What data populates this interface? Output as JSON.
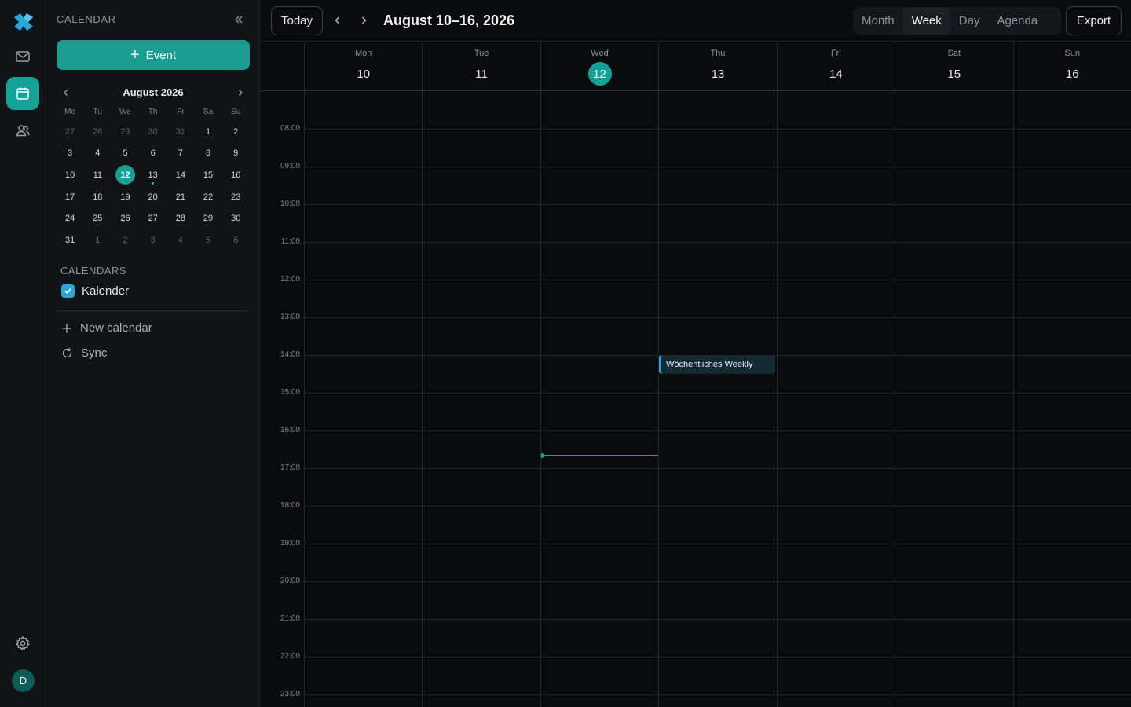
{
  "rail": {
    "items": [
      "mail-icon",
      "calendar-icon",
      "contacts-icon"
    ],
    "settings": "gear-icon",
    "avatar_initial": "D",
    "accent": "#14a198"
  },
  "panel": {
    "title": "CALENDAR",
    "new_event_label": "Event",
    "mini_calendar": {
      "month_label": "August 2026",
      "weekdays": [
        "Mo",
        "Tu",
        "We",
        "Th",
        "Fr",
        "Sa",
        "Su"
      ],
      "weeks": [
        [
          "27",
          "28",
          "29",
          "30",
          "31",
          "1",
          "2"
        ],
        [
          "3",
          "4",
          "5",
          "6",
          "7",
          "8",
          "9"
        ],
        [
          "10",
          "11",
          "12",
          "13",
          "14",
          "15",
          "16"
        ],
        [
          "17",
          "18",
          "19",
          "20",
          "21",
          "22",
          "23"
        ],
        [
          "24",
          "25",
          "26",
          "27",
          "28",
          "29",
          "30"
        ],
        [
          "31",
          "1",
          "2",
          "3",
          "4",
          "5",
          "6"
        ]
      ],
      "today": "12",
      "event_dot_day": "13"
    },
    "calendars_heading": "CALENDARS",
    "calendars": [
      {
        "name": "Kalender",
        "checked": true,
        "color": "#2aa6d9"
      }
    ],
    "new_calendar_label": "New calendar",
    "sync_label": "Sync"
  },
  "toolbar": {
    "today_label": "Today",
    "range_title": "August 10–16, 2026",
    "views": [
      "Month",
      "Week",
      "Day",
      "Agenda"
    ],
    "active_view": "Week",
    "export_label": "Export"
  },
  "week": {
    "days": [
      {
        "dow": "Mon",
        "num": "10"
      },
      {
        "dow": "Tue",
        "num": "11"
      },
      {
        "dow": "Wed",
        "num": "12",
        "today": true
      },
      {
        "dow": "Thu",
        "num": "13"
      },
      {
        "dow": "Fri",
        "num": "14"
      },
      {
        "dow": "Sat",
        "num": "15"
      },
      {
        "dow": "Sun",
        "num": "16"
      }
    ],
    "hours": [
      "08:00",
      "09:00",
      "10:00",
      "11:00",
      "12:00",
      "13:00",
      "14:00",
      "15:00",
      "16:00",
      "17:00",
      "18:00",
      "19:00",
      "20:00",
      "21:00",
      "22:00",
      "23:00"
    ],
    "events": [
      {
        "title": "Wöchentliches Weekly",
        "day": "Thu",
        "start": "14:00"
      }
    ]
  }
}
